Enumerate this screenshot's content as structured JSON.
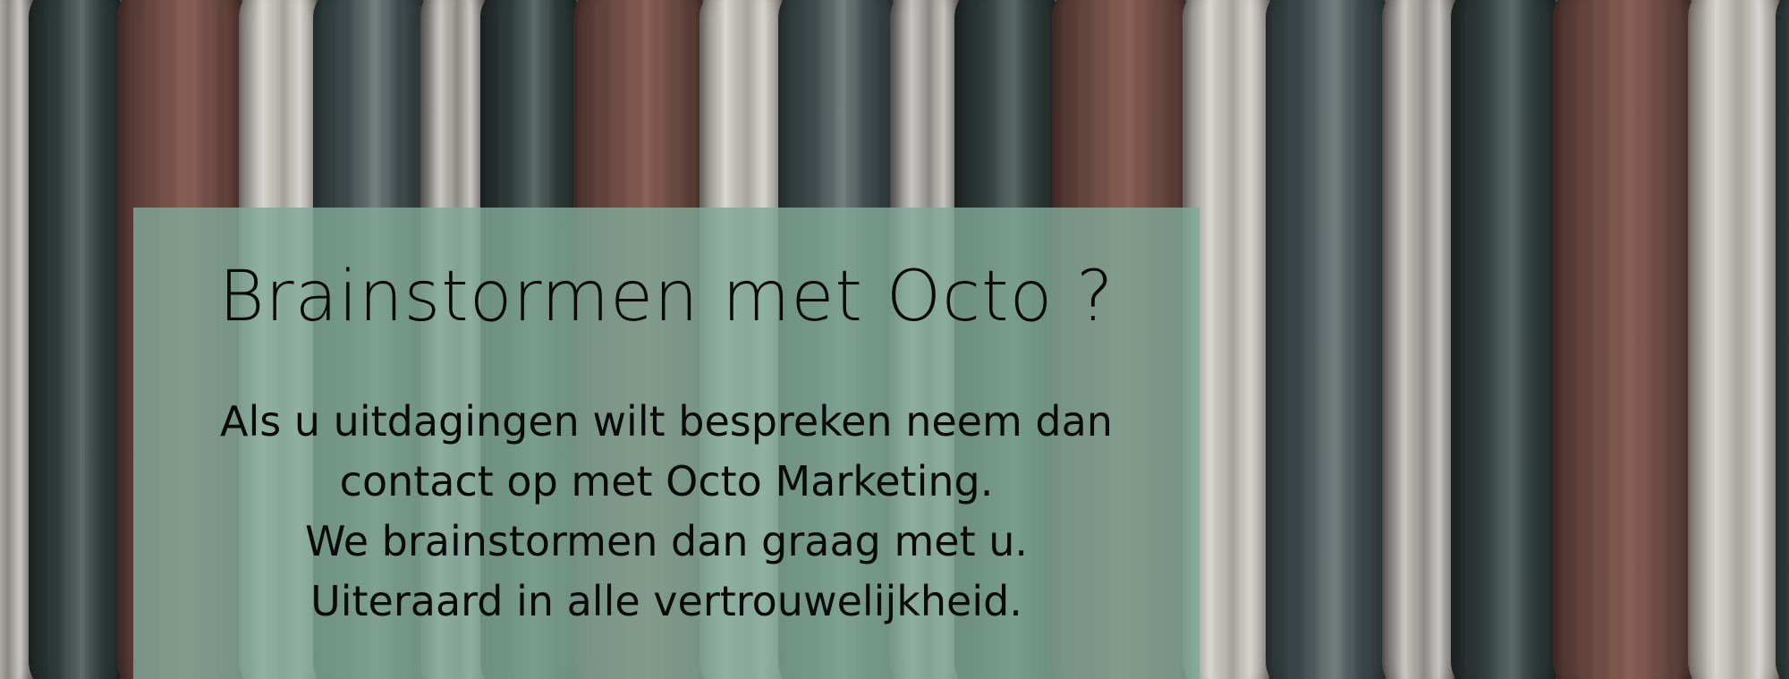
{
  "hero": {
    "title": "Brainstormen met Octo ?",
    "lines": [
      "Als u uitdagingen wilt bespreken neem dan",
      "contact op met Octo Marketing.",
      "We brainstormen dan graag met u.",
      "Uiteraard in alle vertrouwelijkheid."
    ]
  },
  "colors": {
    "panel": "#80a898",
    "text": "#0a0a0a"
  }
}
